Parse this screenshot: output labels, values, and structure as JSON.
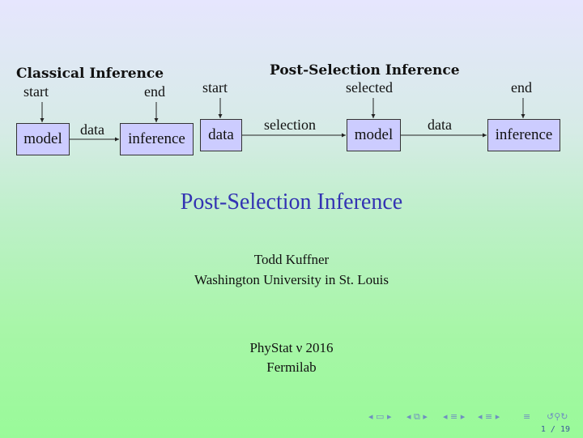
{
  "classical": {
    "heading": "Classical Inference",
    "start_label": "start",
    "end_label": "end",
    "boxes": [
      "model",
      "inference"
    ],
    "edge_label": "data"
  },
  "post_selection": {
    "heading": "Post-Selection Inference",
    "start_label": "start",
    "selected_label": "selected",
    "end_label": "end",
    "boxes": [
      "data",
      "model",
      "inference"
    ],
    "edge_labels": [
      "selection",
      "data"
    ]
  },
  "title": "Post-Selection Inference",
  "author": "Todd Kuffner",
  "institute": "Washington University in St. Louis",
  "event": "PhyStat ν 2016",
  "venue": "Fermilab",
  "navigation": {
    "icons": [
      "frame-prev-icon",
      "slide-icon",
      "frame-next-icon",
      "section-prev-icon",
      "frame-stack-icon",
      "section-next-icon",
      "subsection-prev-icon",
      "subsection-icon",
      "subsection-next-icon",
      "toc-prev-icon",
      "toc-icon",
      "toc-next-icon",
      "align-icon",
      "back-icon",
      "search-icon",
      "forward-icon"
    ],
    "page": "1 / 19"
  },
  "colors": {
    "box_fill": "#ccccff",
    "title": "#3333b3",
    "bg_top": "#e6e6fe",
    "bg_bottom": "#99fa99"
  }
}
